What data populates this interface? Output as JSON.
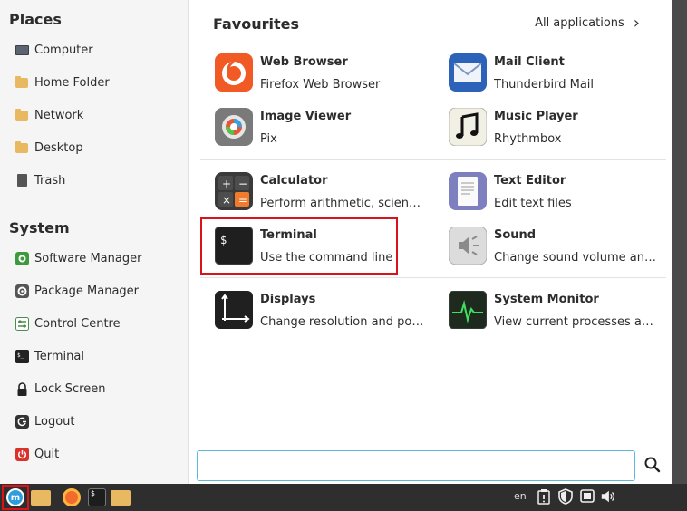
{
  "places": {
    "heading": "Places",
    "items": [
      {
        "label": "Computer",
        "icon": "computer-icon"
      },
      {
        "label": "Home Folder",
        "icon": "home-folder-icon"
      },
      {
        "label": "Network",
        "icon": "network-folder-icon"
      },
      {
        "label": "Desktop",
        "icon": "desktop-folder-icon"
      },
      {
        "label": "Trash",
        "icon": "trash-icon"
      }
    ]
  },
  "system": {
    "heading": "System",
    "items": [
      {
        "label": "Software Manager",
        "icon": "software-manager-icon"
      },
      {
        "label": "Package Manager",
        "icon": "package-manager-icon"
      },
      {
        "label": "Control Centre",
        "icon": "control-centre-icon"
      },
      {
        "label": "Terminal",
        "icon": "terminal-icon"
      },
      {
        "label": "Lock Screen",
        "icon": "lock-icon"
      },
      {
        "label": "Logout",
        "icon": "logout-icon"
      },
      {
        "label": "Quit",
        "icon": "power-icon"
      }
    ]
  },
  "favourites": {
    "heading": "Favourites",
    "all_apps_label": "All applications",
    "apps": [
      {
        "name": "Web Browser",
        "desc": "Firefox Web Browser",
        "icon": "firefox-icon"
      },
      {
        "name": "Mail Client",
        "desc": "Thunderbird Mail",
        "icon": "mail-icon"
      },
      {
        "name": "Image Viewer",
        "desc": "Pix",
        "icon": "image-viewer-icon"
      },
      {
        "name": "Music Player",
        "desc": "Rhythmbox",
        "icon": "music-icon"
      },
      {
        "name": "Calculator",
        "desc": "Perform arithmetic, scientific or financial calculations",
        "icon": "calculator-icon"
      },
      {
        "name": "Text Editor",
        "desc": "Edit text files",
        "icon": "text-editor-icon"
      },
      {
        "name": "Terminal",
        "desc": "Use the command line",
        "icon": "terminal-icon"
      },
      {
        "name": "Sound",
        "desc": "Change sound volume and sound events",
        "icon": "sound-icon"
      },
      {
        "name": "Displays",
        "desc": "Change resolution and position of monitors",
        "icon": "displays-icon"
      },
      {
        "name": "System Monitor",
        "desc": "View current processes and monitor system state",
        "icon": "system-monitor-icon"
      }
    ]
  },
  "search": {
    "value": "",
    "placeholder": ""
  },
  "taskbar": {
    "language": "en",
    "terminal_glyph": "$_"
  },
  "colors": {
    "highlight": "#d8141a",
    "accent": "#2f9ddb",
    "search_border": "#5fb7df"
  }
}
